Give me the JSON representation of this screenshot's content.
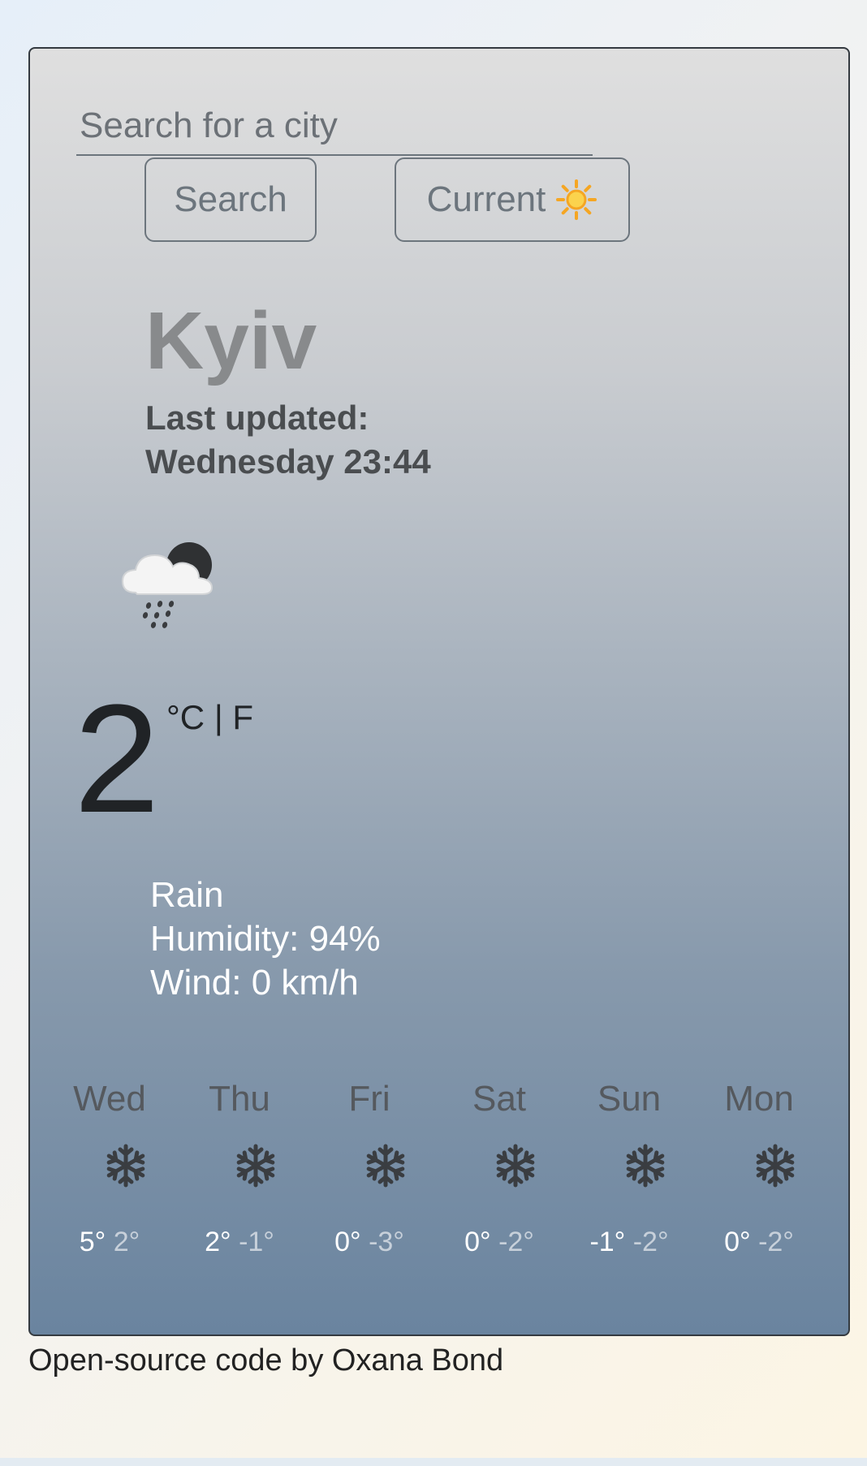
{
  "search": {
    "placeholder": "Search for a city",
    "value": ""
  },
  "buttons": {
    "search_label": "Search",
    "current_label": "Current",
    "current_icon": "sun-icon"
  },
  "location": {
    "city": "Kyiv",
    "updated_label": "Last updated:",
    "updated_time": "Wednesday 23:44"
  },
  "current": {
    "icon": "night-rain-cloud-icon",
    "temperature": "2",
    "unit_c": "°C",
    "unit_sep": "|",
    "unit_f": "F",
    "description": "Rain",
    "humidity": "Humidity: 94%",
    "wind": "Wind: 0 km/h"
  },
  "forecast": [
    {
      "day": "Wed",
      "icon": "snowflake-icon",
      "max": "5°",
      "min": "2°"
    },
    {
      "day": "Thu",
      "icon": "snowflake-icon",
      "max": "2°",
      "min": "-1°"
    },
    {
      "day": "Fri",
      "icon": "snowflake-icon",
      "max": "0°",
      "min": "-3°"
    },
    {
      "day": "Sat",
      "icon": "snowflake-icon",
      "max": "0°",
      "min": "-2°"
    },
    {
      "day": "Sun",
      "icon": "snowflake-icon",
      "max": "-1°",
      "min": "-2°"
    },
    {
      "day": "Mon",
      "icon": "snowflake-icon",
      "max": "0°",
      "min": "-2°"
    }
  ],
  "footer": {
    "text": "Open-source code by Oxana Bond"
  },
  "colors": {
    "card_top": "#dfdfdf",
    "card_bottom": "#6a849f",
    "city_text": "#888a8c",
    "button_border": "#6c757d",
    "sun_orange": "#f5a623"
  }
}
